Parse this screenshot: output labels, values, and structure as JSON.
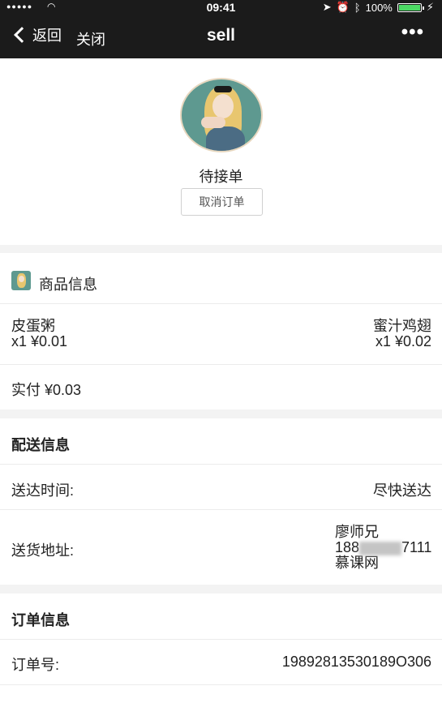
{
  "statusbar": {
    "dots": "●●●●●",
    "time": "09:41",
    "battery": "100%",
    "icons": [
      "wifi-icon",
      "location-icon",
      "alarm-icon",
      "bluetooth-icon",
      "battery-icon",
      "charging-icon"
    ]
  },
  "nav": {
    "back": "返回",
    "close": "关闭",
    "title": "sell",
    "more": "•••"
  },
  "order_status": {
    "status": "待接单",
    "cancel": "取消订单"
  },
  "goods": {
    "section_title": "商品信息",
    "items": [
      {
        "name": "皮蛋粥",
        "qty_price": "x1 ¥0.01"
      },
      {
        "name": "蜜汁鸡翅",
        "qty_price": "x1 ¥0.02"
      }
    ],
    "total": "实付 ¥0.03"
  },
  "delivery": {
    "section_title": "配送信息",
    "time_label": "送达时间:",
    "time_value": "尽快送达",
    "address_label": "送货地址:",
    "name": "廖师兄",
    "phone_prefix": "188",
    "phone_suffix": "7111",
    "address": "慕课网"
  },
  "order": {
    "section_title": "订单信息",
    "id_label": "订单号:",
    "id_value": "19892813530189O306"
  },
  "colors": {
    "navbar": "#1b1b1b",
    "page_bg": "#f3f3f3",
    "battery": "#4cd964"
  }
}
